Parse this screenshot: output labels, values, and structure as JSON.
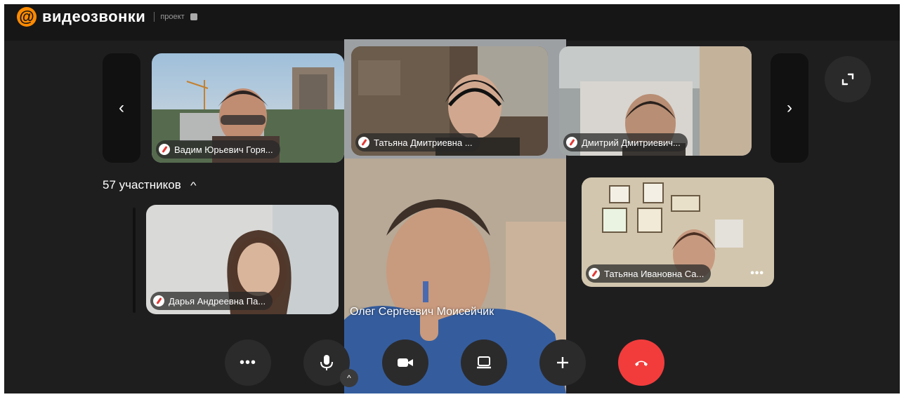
{
  "app": {
    "logo_text": "видеозвонки",
    "logo_sub": "проект"
  },
  "participants_count": "57 участников",
  "tiles": [
    {
      "name": "Вадим Юрьевич Горя..."
    },
    {
      "name": "Татьяна Дмитриевна ..."
    },
    {
      "name": "Дмитрий Дмитриевич..."
    },
    {
      "name": "Дарья Андреевна Па..."
    },
    {
      "name": "Татьяна Ивановна Са..."
    }
  ],
  "main_speaker": {
    "name": "Олег Сергеевич Моисейчик"
  },
  "controls": [
    "more-icon",
    "mic-icon",
    "camera-icon",
    "screen-share-icon",
    "add-icon",
    "end-call-icon"
  ],
  "colors": {
    "brand": "#ff8a00",
    "end_call": "#f23c3c",
    "mute": "#e53935",
    "background": "#1e1e1f"
  }
}
